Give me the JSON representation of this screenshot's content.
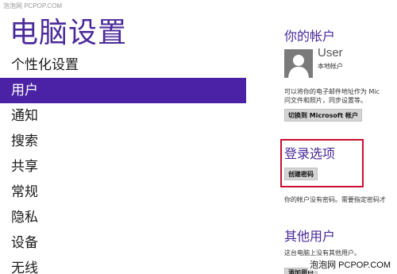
{
  "watermark_top": "泡泡网 PCPOP.COM",
  "title": "电脑设置",
  "nav": [
    {
      "label": "个性化设置",
      "active": false
    },
    {
      "label": "用户",
      "active": true
    },
    {
      "label": "通知",
      "active": false
    },
    {
      "label": "搜索",
      "active": false
    },
    {
      "label": "共享",
      "active": false
    },
    {
      "label": "常规",
      "active": false
    },
    {
      "label": "隐私",
      "active": false
    },
    {
      "label": "设备",
      "active": false
    },
    {
      "label": "无线",
      "active": false
    }
  ],
  "account": {
    "section_title": "你的帐户",
    "user_name": "User",
    "user_type": "本地帐户",
    "desc_line1": "可以将你的电子邮件地址作为 Mic",
    "desc_line2": "问文件和照片，同步设置等。",
    "switch_button": "切换到 Microsoft 帐户"
  },
  "login": {
    "section_title": "登录选项",
    "create_password_button": "创建密码",
    "desc": "你的帐户没有密码。需要指定密码才"
  },
  "other_users": {
    "section_title": "其他用户",
    "desc": "这台电脑上没有其他用户。",
    "add_button": "添加用户"
  },
  "watermark_bottom": "泡泡网 PCPOP.COM",
  "colors": {
    "accent": "#4b22a5",
    "title": "#4a2a9a",
    "highlight": "#c8102e"
  }
}
